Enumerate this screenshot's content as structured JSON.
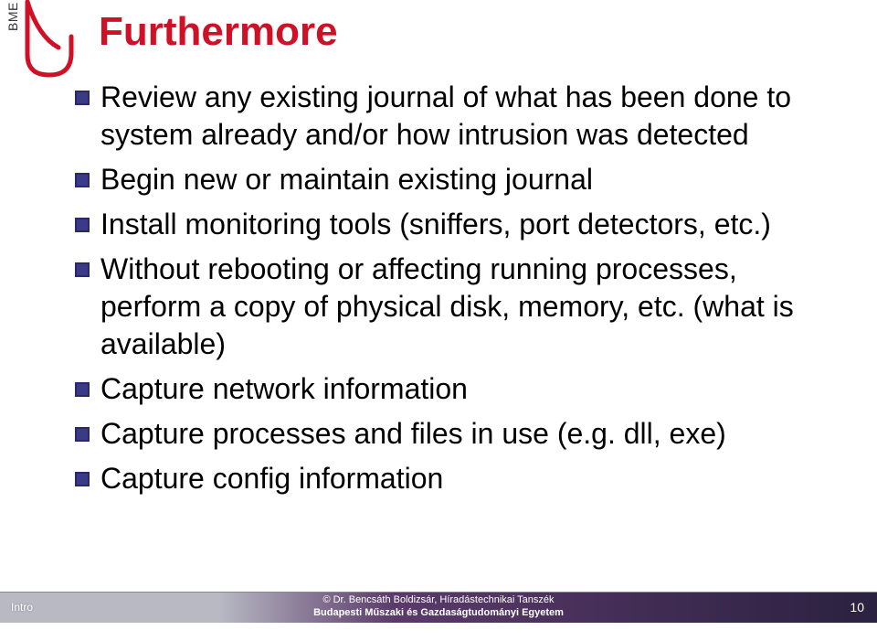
{
  "logo": {
    "bme_label": "BME"
  },
  "title": "Furthermore",
  "bullets": [
    "Review any existing journal of what has been done to system already and/or how intrusion was detected",
    "Begin new or maintain existing journal",
    "Install monitoring tools (sniffers, port detectors, etc.)",
    "Without rebooting or affecting running processes, perform a copy of physical disk, memory, etc. (what is available)",
    "Capture network information",
    "Capture processes and files in use (e.g. dll, exe)",
    "Capture config information"
  ],
  "footer": {
    "left": "Intro",
    "center_line1": "© Dr. Bencsáth Boldizsár, Híradástechnikai Tanszék",
    "center_line2": "Budapesti Műszaki és Gazdaságtudományi Egyetem",
    "page": "10"
  },
  "colors": {
    "accent": "#ce1126",
    "bullet": "#2a2966"
  }
}
